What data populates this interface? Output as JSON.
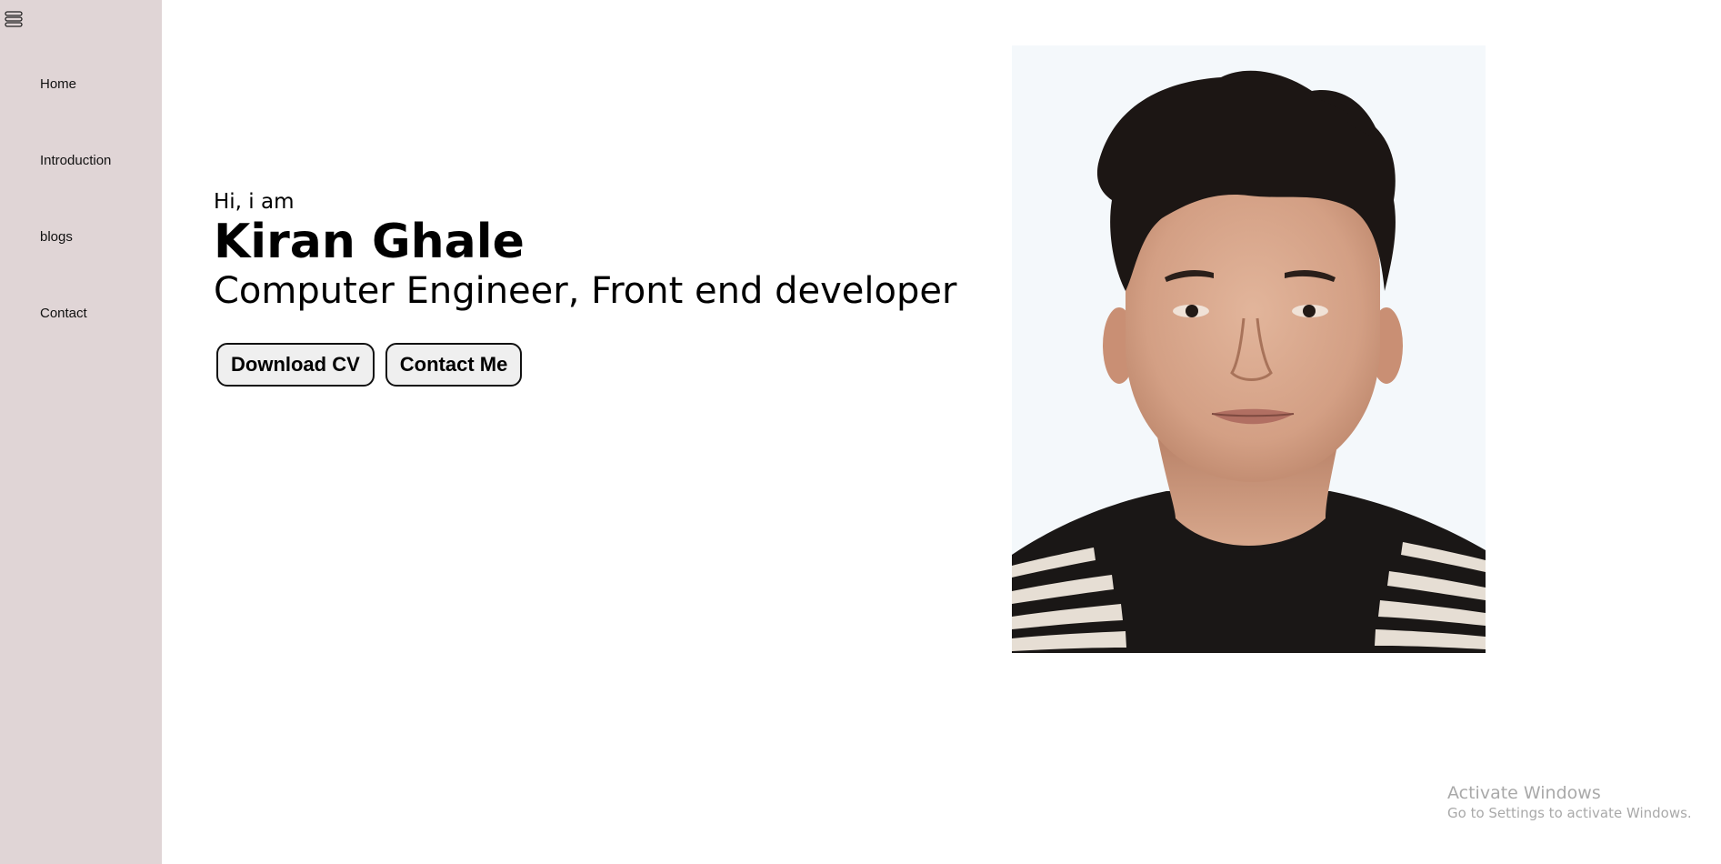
{
  "sidebar": {
    "toggle_icon": "hamburger-menu-icon",
    "items": [
      {
        "label": "Home"
      },
      {
        "label": "Introduction"
      },
      {
        "label": "blogs"
      },
      {
        "label": "Contact"
      }
    ],
    "background": "#e0d5d6"
  },
  "hero": {
    "greeting": "Hi, i am",
    "name": "Kiran Ghale",
    "role": "Computer Engineer, Front end developer",
    "buttons": {
      "download_cv": "Download CV",
      "contact_me": "Contact Me"
    }
  },
  "profile_photo": {
    "icon": "profile-portrait"
  },
  "watermark": {
    "title": "Activate Windows",
    "subtitle": "Go to Settings to activate Windows."
  }
}
